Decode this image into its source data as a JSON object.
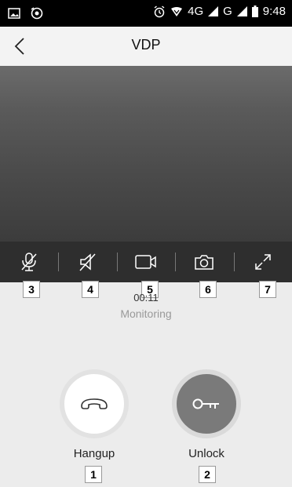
{
  "status_bar": {
    "time": "9:48",
    "network_4g": "4G",
    "network_g": "G",
    "icons": [
      "gallery-icon",
      "sync-icon",
      "alarm-icon",
      "data-icon",
      "signal-icon",
      "battery-icon"
    ]
  },
  "header": {
    "title": "VDP",
    "back_icon": "chevron-left-icon"
  },
  "toolbar": {
    "tools": [
      {
        "name": "mic-off",
        "icon": "mic-off-icon",
        "badge": "3"
      },
      {
        "name": "speaker-off",
        "icon": "speaker-off-icon",
        "badge": "4"
      },
      {
        "name": "record-video",
        "icon": "video-camera-icon",
        "badge": "5"
      },
      {
        "name": "snapshot",
        "icon": "camera-icon",
        "badge": "6"
      },
      {
        "name": "fullscreen",
        "icon": "expand-icon",
        "badge": "7"
      }
    ]
  },
  "call": {
    "timer": "00:11",
    "status": "Monitoring"
  },
  "actions": {
    "hangup_label": "Hangup",
    "hangup_badge": "1",
    "unlock_label": "Unlock",
    "unlock_badge": "2"
  },
  "colors": {
    "toolbar_bg": "#2e2e2e",
    "unlock_bg": "#7a7a7a",
    "page_bg": "#ececec"
  }
}
